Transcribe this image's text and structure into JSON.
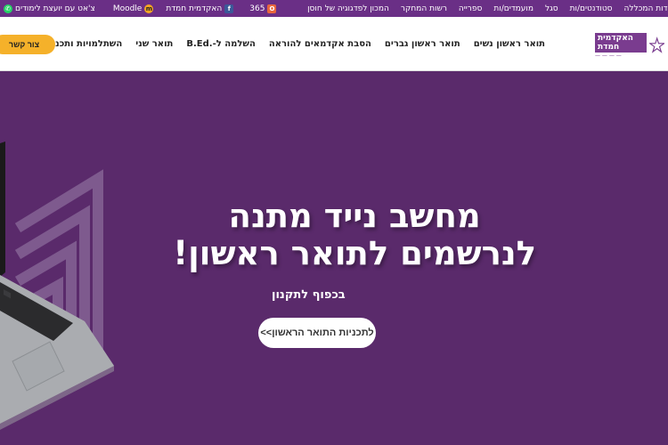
{
  "topbar": {
    "right_links": [
      "אודות המכללה",
      "סטודנטים/ות",
      "סגל",
      "מועמדים/ות",
      "ספרייה",
      "רשות המחקר",
      "המכון לפדגוגיה של חוסן"
    ],
    "office_label": "365",
    "academy_label": "האקדמית חמדת",
    "moodle_label": "Moodle",
    "chat_label": "צ'אט עם יועצת לימודים"
  },
  "nav": {
    "logo_text": "האקדמית חמדת",
    "items": [
      "תואר ראשון נשים",
      "תואר ראשון גברים",
      "הסבת אקדמאים להוראה",
      "השלמה ל-.B.Ed",
      "תואר שני",
      "השתלמויות ותכניות חוץ"
    ],
    "cta_label": "צור קשר"
  },
  "hero": {
    "line1": "מחשב נייד מתנה",
    "line2": "לנרשמים לתואר ראשון!",
    "sub": "בכפוף לתקנון",
    "button": "לתכניות התואר הראשון>>"
  },
  "colors": {
    "topbar": "#6a2f86",
    "hero": "#5a2a6b",
    "cta": "#f5b12a"
  }
}
